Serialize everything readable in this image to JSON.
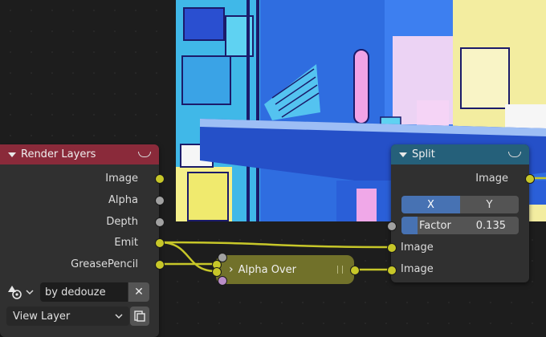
{
  "render_layers": {
    "title": "Render Layers",
    "outputs": [
      "Image",
      "Alpha",
      "Depth",
      "Emit",
      "GreasePencil"
    ],
    "scene_name": "by dedouze",
    "view_layer": "View Layer"
  },
  "alpha_over": {
    "title": "Alpha Over"
  },
  "split": {
    "title": "Split",
    "output_label": "Image",
    "axis_x": "X",
    "axis_y": "Y",
    "factor_label": "Factor",
    "factor_value": "0.135",
    "factor_fraction": 0.135,
    "inputs": [
      "Image",
      "Image"
    ]
  },
  "colors": {
    "render_header": "#8a2a3a",
    "split_header": "#25607a",
    "alpha_over_body": "#71712a",
    "socket_color": "#c7c729",
    "socket_value": "#a1a1a1",
    "socket_vector": "#b98dc7",
    "accent": "#4772b3"
  },
  "icons": {
    "scene": "scene-icon",
    "clear": "x-icon",
    "browse": "browse-icon",
    "collapse": "chevron-down-icon"
  }
}
